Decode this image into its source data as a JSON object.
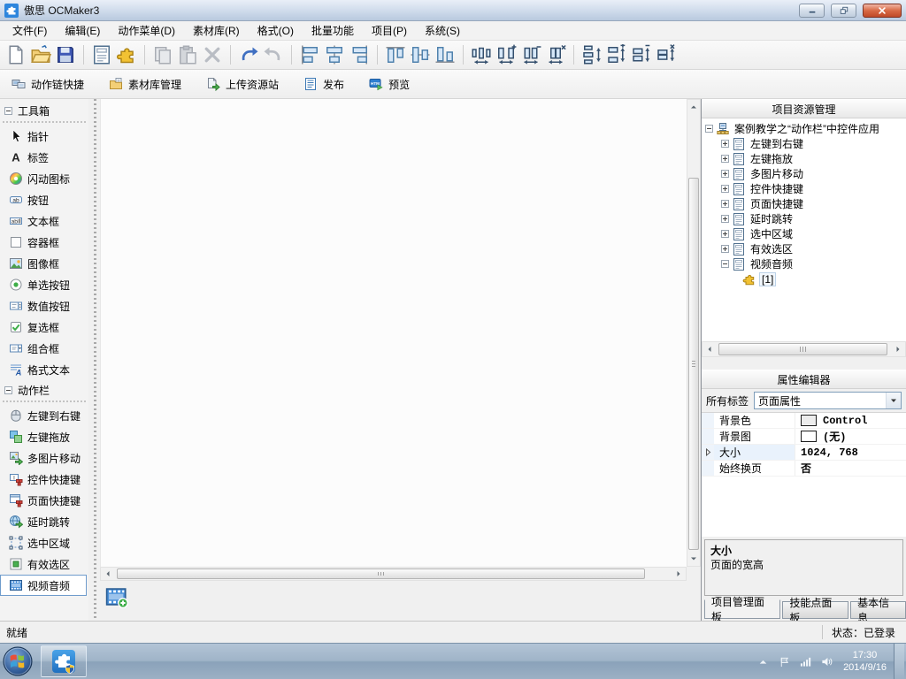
{
  "window": {
    "title": "傲思 OCMaker3",
    "app_icon": "app",
    "buttons": [
      {
        "icon": "minimize"
      },
      {
        "icon": "restore"
      },
      {
        "icon": "close"
      }
    ]
  },
  "menubar": [
    "文件(F)",
    "编辑(E)",
    "动作菜单(D)",
    "素材库(R)",
    "格式(O)",
    "批量功能",
    "项目(P)",
    "系统(S)"
  ],
  "toolbar_main": [
    {
      "buttons": [
        {
          "icon": "new-document",
          "disabled": false
        },
        {
          "icon": "open-folder",
          "disabled": false
        },
        {
          "icon": "save",
          "disabled": false
        }
      ]
    },
    {
      "buttons": [
        {
          "icon": "form",
          "disabled": false
        },
        {
          "icon": "puzzle",
          "disabled": false
        }
      ]
    },
    {
      "buttons": [
        {
          "icon": "copy",
          "disabled": true
        },
        {
          "icon": "paste",
          "disabled": true
        },
        {
          "icon": "delete",
          "disabled": true
        }
      ]
    },
    {
      "buttons": [
        {
          "icon": "undo",
          "disabled": false
        },
        {
          "icon": "redo",
          "disabled": true
        }
      ]
    },
    {
      "buttons": [
        {
          "icon": "align-left",
          "disabled": false
        },
        {
          "icon": "align-center",
          "disabled": false
        },
        {
          "icon": "align-right",
          "disabled": false
        }
      ]
    },
    {
      "buttons": [
        {
          "icon": "align-top",
          "disabled": false
        },
        {
          "icon": "align-middle",
          "disabled": false
        },
        {
          "icon": "align-bottom",
          "disabled": false
        }
      ]
    },
    {
      "buttons": [
        {
          "icon": "space-h-equal",
          "disabled": false
        },
        {
          "icon": "space-h-inc",
          "disabled": false
        },
        {
          "icon": "space-h-dec",
          "disabled": false
        },
        {
          "icon": "space-h-rem",
          "disabled": false
        }
      ]
    },
    {
      "buttons": [
        {
          "icon": "space-v-equal",
          "disabled": false
        },
        {
          "icon": "space-v-inc",
          "disabled": false
        },
        {
          "icon": "space-v-dec",
          "disabled": false
        },
        {
          "icon": "space-v-rem",
          "disabled": false
        }
      ]
    }
  ],
  "toolbar_actions": [
    {
      "label": "动作链快捷",
      "icon": "action-chain"
    },
    {
      "label": "素材库管理",
      "icon": "material-library"
    },
    {
      "label": "上传资源站",
      "icon": "upload"
    },
    {
      "label": "发布",
      "icon": "publish"
    },
    {
      "label": "预览",
      "icon": "preview"
    }
  ],
  "toolbox": {
    "groups": [
      {
        "title": "工具箱",
        "icon": "tree-minus",
        "items": [
          {
            "label": "指针",
            "icon": "pointer"
          },
          {
            "label": "标签",
            "icon": "label"
          },
          {
            "label": "闪动图标",
            "icon": "flash-icon"
          },
          {
            "label": "按钮",
            "icon": "button"
          },
          {
            "label": "文本框",
            "icon": "textbox"
          },
          {
            "label": "容器框",
            "icon": "container"
          },
          {
            "label": "图像框",
            "icon": "imagebox"
          },
          {
            "label": "单选按钮",
            "icon": "radio"
          },
          {
            "label": "数值按钮",
            "icon": "numeric"
          },
          {
            "label": "复选框",
            "icon": "checkbox"
          },
          {
            "label": "组合框",
            "icon": "combobox"
          },
          {
            "label": "格式文本",
            "icon": "richtext"
          }
        ]
      },
      {
        "title": "动作栏",
        "icon": "tree-minus",
        "items": [
          {
            "label": "左键到右键",
            "icon": "mouse"
          },
          {
            "label": "左键拖放",
            "icon": "dragdrop"
          },
          {
            "label": "多图片移动",
            "icon": "multi-image"
          },
          {
            "label": "控件快捷键",
            "icon": "control-hotkey"
          },
          {
            "label": "页面快捷键",
            "icon": "page-hotkey"
          },
          {
            "label": "延时跳转",
            "icon": "delay-jump"
          },
          {
            "label": "选中区域",
            "icon": "select-area"
          },
          {
            "label": "有效选区",
            "icon": "valid-area"
          },
          {
            "label": "视频音频",
            "icon": "video-audio",
            "selected": true
          }
        ]
      }
    ]
  },
  "canvas": {
    "placed_icon": "video-audio-add"
  },
  "resource_panel": {
    "title": "项目资源管理",
    "root": {
      "label": "案例教学之“动作栏”中控件应用",
      "icon": "tree-root"
    },
    "pages": [
      "左键到右键",
      "左键拖放",
      "多图片移动",
      "控件快捷键",
      "页面快捷键",
      "延时跳转",
      "选中区域",
      "有效选区",
      "视频音频"
    ],
    "leaf": {
      "label": "[1]",
      "icon": "puzzle"
    }
  },
  "property_editor": {
    "title": "属性编辑器",
    "filter_label": "所有标签",
    "selected_tag": "页面属性",
    "rows": [
      {
        "name": "背景色",
        "value": "Control",
        "swatch": "#ececec"
      },
      {
        "name": "背景图",
        "value": "(无)",
        "swatch": "#ffffff"
      },
      {
        "name": "大小",
        "value": "1024, 768",
        "expandable": true,
        "selected": true
      },
      {
        "name": "始终换页",
        "value": "否"
      }
    ],
    "help_title": "大小",
    "help_text": "页面的宽高"
  },
  "panel_tabs": [
    {
      "label": "项目管理面板",
      "active": true
    },
    {
      "label": "技能点面板",
      "active": false
    },
    {
      "label": "基本信息",
      "active": false
    }
  ],
  "statusbar": {
    "message": "就绪",
    "login_status": "状态：已登录"
  },
  "taskbar": {
    "time": "17:30",
    "date": "2014/9/16",
    "tray_icons": [
      "chevron-up",
      "action-flag",
      "network",
      "volume"
    ]
  }
}
